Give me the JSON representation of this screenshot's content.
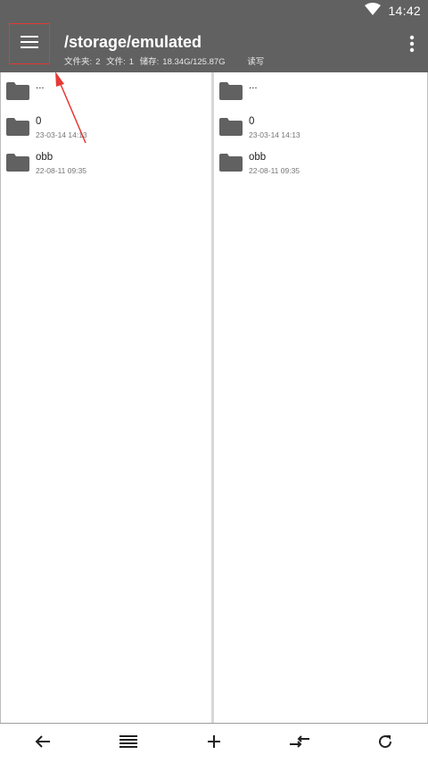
{
  "status": {
    "time": "14:42"
  },
  "toolbar": {
    "title": "/storage/emulated",
    "folders_label": "文件夹:",
    "folders_count": "2",
    "files_label": "文件:",
    "files_count": "1",
    "storage_label": "储存:",
    "storage_value": "18.34G/125.87G",
    "mode": "读写"
  },
  "left_pane": {
    "items": [
      {
        "name": "...",
        "date": ""
      },
      {
        "name": "0",
        "date": "23-03-14 14:13"
      },
      {
        "name": "obb",
        "date": "22-08-11 09:35"
      }
    ]
  },
  "right_pane": {
    "items": [
      {
        "name": "...",
        "date": ""
      },
      {
        "name": "0",
        "date": "23-03-14 14:13"
      },
      {
        "name": "obb",
        "date": "22-08-11 09:35"
      }
    ]
  },
  "icons": {
    "menu": "menu-icon",
    "more": "more-vert-icon",
    "folder": "folder-icon",
    "back": "arrow-left-icon",
    "list": "list-icon",
    "add": "plus-icon",
    "swap": "swap-icon",
    "refresh": "refresh-icon",
    "wifi": "wifi-icon"
  },
  "colors": {
    "toolbar": "#616161",
    "highlight_box": "#e53935",
    "annotation_arrow": "#e53935",
    "folder": "#616161"
  }
}
